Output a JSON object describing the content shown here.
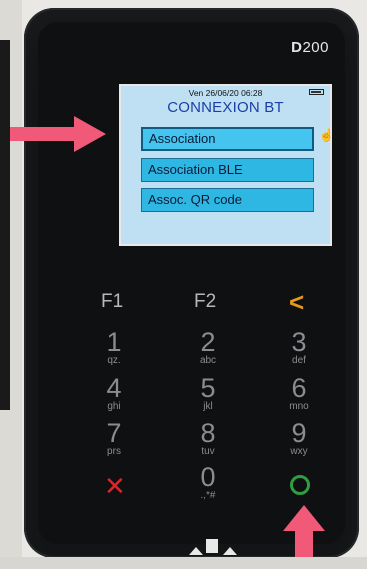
{
  "device": {
    "model_prefix": "D",
    "model_number": "200"
  },
  "screen": {
    "status_datetime": "Ven 26/06/20 06:28",
    "title": "CONNEXION BT",
    "menu": [
      {
        "label": "Association",
        "selected": true
      },
      {
        "label": "Association BLE",
        "selected": false
      },
      {
        "label": "Assoc. QR code",
        "selected": false
      }
    ]
  },
  "keypad": {
    "f1": "F1",
    "f2": "F2",
    "back_icon": "chevron-left-icon",
    "keys": [
      {
        "num": "1",
        "sub": "qz."
      },
      {
        "num": "2",
        "sub": "abc"
      },
      {
        "num": "3",
        "sub": "def"
      },
      {
        "num": "4",
        "sub": "ghi"
      },
      {
        "num": "5",
        "sub": "jkl"
      },
      {
        "num": "6",
        "sub": "mno"
      },
      {
        "num": "7",
        "sub": "prs"
      },
      {
        "num": "8",
        "sub": "tuv"
      },
      {
        "num": "9",
        "sub": "wxy"
      },
      {
        "num": "0",
        "sub": ".,*#"
      }
    ],
    "cancel_icon": "cancel-x-icon",
    "ok_icon": "ok-circle-icon"
  },
  "colors": {
    "arrow": "#f05a78",
    "screen_bg": "#bfe0f2",
    "menu_item": "#2fb7e4",
    "title": "#1b3fa6"
  }
}
